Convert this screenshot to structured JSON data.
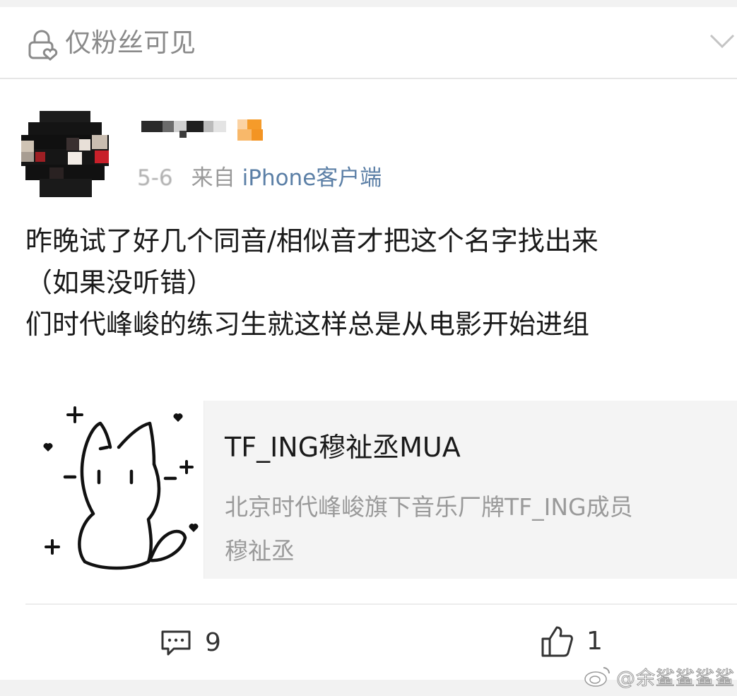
{
  "visibility": {
    "label": "仅粉丝可见"
  },
  "post": {
    "date": "5-6",
    "source_prefix": "来自",
    "source_client": "iPhone客户端",
    "lines": [
      "昨晚试了好几个同音/相似音才把这个名字找出来",
      "（如果没听错）",
      "们时代峰峻的练习生就这样总是从电影开始进组"
    ]
  },
  "link_preview": {
    "title": "TF_ING穆祉丞MUA",
    "description_lines": [
      "北京时代峰峻旗下音乐厂牌TF_ING成员",
      "穆祉丞"
    ]
  },
  "actions": {
    "comments_count": "9",
    "likes_count": "1"
  },
  "watermark": {
    "text": "@余鲨鲨鲨鲨"
  },
  "icons": {
    "visibility": "lock-heart-icon",
    "expand": "chevron-down-icon",
    "comment": "comment-icon",
    "like": "thumbs-up-icon",
    "watermark_logo": "weibo-logo-icon"
  },
  "colors": {
    "link": "#5b7fa6",
    "muted_text": "#9a9a9a",
    "body_text": "#1a1a1a"
  }
}
